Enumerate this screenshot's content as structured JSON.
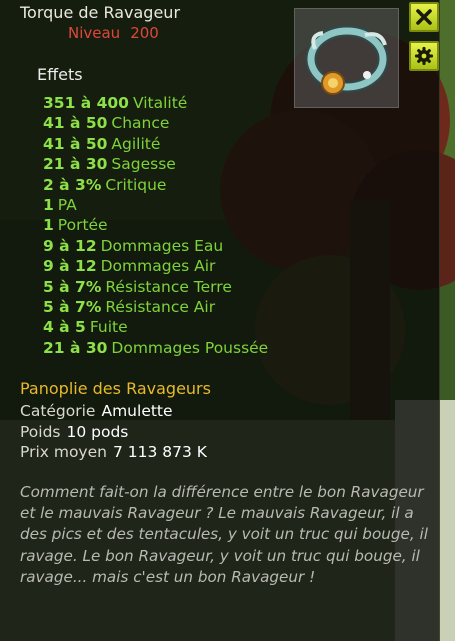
{
  "item": {
    "name": "Torque de Ravageur",
    "level_label": "Niveau",
    "level_value": "200"
  },
  "effects": {
    "title": "Effets",
    "lines": [
      {
        "value": "351 à 400",
        "name": "Vitalité"
      },
      {
        "value": "41 à 50",
        "name": "Chance"
      },
      {
        "value": "41 à 50",
        "name": "Agilité"
      },
      {
        "value": "21 à 30",
        "name": "Sagesse"
      },
      {
        "value": "2 à 3%",
        "name": "Critique"
      },
      {
        "value": "1",
        "name": "PA"
      },
      {
        "value": "1",
        "name": "Portée"
      },
      {
        "value": "9 à 12",
        "name": "Dommages Eau"
      },
      {
        "value": "9 à 12",
        "name": "Dommages Air"
      },
      {
        "value": "5 à 7%",
        "name": "Résistance Terre"
      },
      {
        "value": "5 à 7%",
        "name": "Résistance Air"
      },
      {
        "value": "4 à 5",
        "name": "Fuite"
      },
      {
        "value": "21 à 30",
        "name": "Dommages Poussée"
      }
    ]
  },
  "set": {
    "name": "Panoplie des Ravageurs"
  },
  "properties": {
    "category_label": "Catégorie",
    "category_value": "Amulette",
    "weight_label": "Poids",
    "weight_value": "10 pods",
    "price_label": "Prix moyen",
    "price_value": "7 113 873 K"
  },
  "description": "Comment fait-on la différence entre le bon Ravageur et le mauvais Ravageur ? Le mauvais Ravageur, il a des pics et des tentacules, y voit un truc qui bouge, il ravage. Le bon Ravageur, y voit un truc qui bouge, il ravage... mais c'est un bon Ravageur !",
  "buttons": {
    "close_icon": "close-icon",
    "settings_icon": "gear-icon"
  },
  "colors": {
    "title": "#e9e9e0",
    "level": "#e0463a",
    "effect": "#7fd23a",
    "set": "#e8b92c",
    "button": "#d4e632"
  }
}
